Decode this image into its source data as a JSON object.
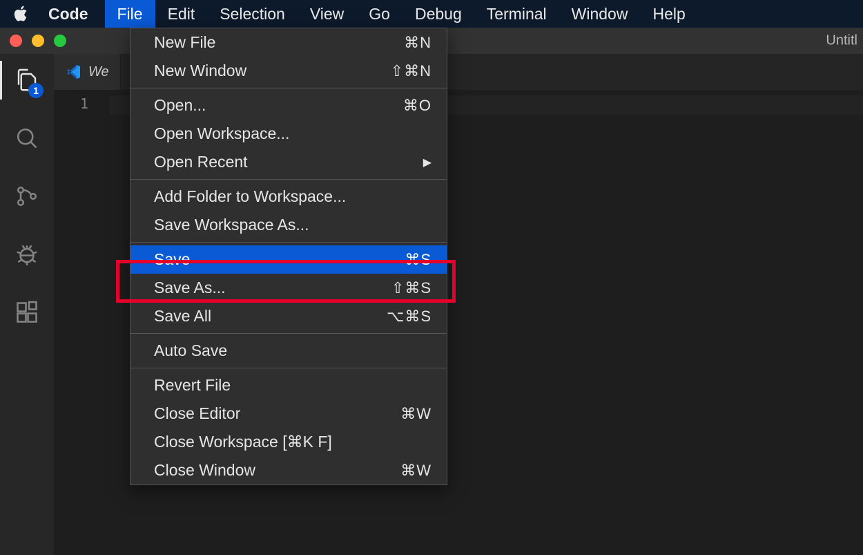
{
  "menubar": {
    "app": "Code",
    "items": [
      "File",
      "Edit",
      "Selection",
      "View",
      "Go",
      "Debug",
      "Terminal",
      "Window",
      "Help"
    ],
    "active_index": 0
  },
  "window": {
    "title_fragment": "Untitl"
  },
  "activitybar": {
    "explorer_badge": "1"
  },
  "tab": {
    "label": "We"
  },
  "gutter": {
    "line1": "1"
  },
  "file_menu": {
    "groups": [
      [
        {
          "label": "New File",
          "shortcut": "⌘N"
        },
        {
          "label": "New Window",
          "shortcut": "⇧⌘N"
        }
      ],
      [
        {
          "label": "Open...",
          "shortcut": "⌘O"
        },
        {
          "label": "Open Workspace...",
          "shortcut": ""
        },
        {
          "label": "Open Recent",
          "shortcut": "",
          "submenu": true
        }
      ],
      [
        {
          "label": "Add Folder to Workspace...",
          "shortcut": ""
        },
        {
          "label": "Save Workspace As...",
          "shortcut": ""
        }
      ],
      [
        {
          "label": "Save",
          "shortcut": "⌘S",
          "selected": true
        },
        {
          "label": "Save As...",
          "shortcut": "⇧⌘S"
        },
        {
          "label": "Save All",
          "shortcut": "⌥⌘S"
        }
      ],
      [
        {
          "label": "Auto Save",
          "shortcut": ""
        }
      ],
      [
        {
          "label": "Revert File",
          "shortcut": ""
        },
        {
          "label": "Close Editor",
          "shortcut": "⌘W"
        },
        {
          "label": "Close Workspace [⌘K F]",
          "shortcut": ""
        },
        {
          "label": "Close Window",
          "shortcut": "⌘W"
        }
      ]
    ]
  },
  "colors": {
    "highlight_red": "#e4002b",
    "selection_blue": "#0a5ad6"
  }
}
